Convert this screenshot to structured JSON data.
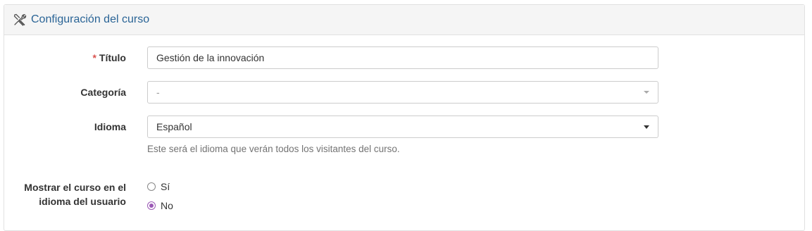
{
  "panel": {
    "title": "Configuración del curso",
    "icon": "tools-icon"
  },
  "form": {
    "title_field": {
      "required_mark": "*",
      "label": "Título",
      "value": "Gestión de la innovación"
    },
    "category_field": {
      "label": "Categoría",
      "value": "-"
    },
    "language_field": {
      "label": "Idioma",
      "value": "Español",
      "help": "Este será el idioma que verán todos los visitantes del curso."
    },
    "show_in_user_language": {
      "label_line1": "Mostrar el curso en el",
      "label_line2": "idioma del usuario",
      "options": [
        {
          "label": "Sí",
          "checked": false
        },
        {
          "label": "No",
          "checked": true
        }
      ]
    }
  },
  "colors": {
    "accent": "#2a6496",
    "radio_checked": "#9b59b6",
    "required": "#d9534f"
  }
}
